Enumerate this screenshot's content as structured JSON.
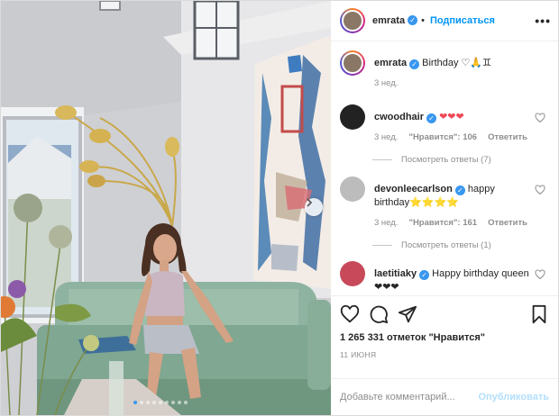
{
  "header": {
    "username": "emrata",
    "separator": "•",
    "follow_label": "Подписаться",
    "more_label": "•••"
  },
  "caption": {
    "username": "emrata",
    "text": "Birthday ♡🙏♊",
    "time": "3 нед."
  },
  "comments": [
    {
      "username": "cwoodhair",
      "text": "❤❤❤",
      "time": "3 нед.",
      "likes": "\"Нравится\": 106",
      "reply": "Ответить",
      "view_replies": "Посмотреть ответы (7)"
    },
    {
      "username": "devonleecarlson",
      "text": "happy birthday⭐⭐⭐⭐",
      "time": "3 нед.",
      "likes": "\"Нравится\": 161",
      "reply": "Ответить",
      "view_replies": "Посмотреть ответы (1)"
    },
    {
      "username": "laetitiaky",
      "text": "Happy birthday queen ❤❤❤",
      "time": "",
      "likes": "",
      "reply": "",
      "view_replies": ""
    }
  ],
  "actions": {
    "like_icon": "heart-icon",
    "comment_icon": "comment-icon",
    "share_icon": "share-icon",
    "save_icon": "bookmark-icon"
  },
  "likes_count": "1 265 331 отметок \"Нравится\"",
  "date": "11 ИЮНЯ",
  "add_comment": {
    "placeholder": "Добавьте комментарий...",
    "post_label": "Опубликовать"
  },
  "carousel": {
    "slide_count": 9,
    "active_index": 0
  },
  "colors": {
    "link": "#0095f6",
    "verified": "#3897f0",
    "post_disabled": "#b2dffc",
    "heart": "#ed4956"
  }
}
